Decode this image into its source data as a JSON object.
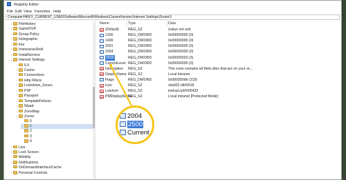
{
  "window": {
    "title": "Registry Editor",
    "menu": [
      "File",
      "Edit",
      "View",
      "Favorites",
      "Help"
    ],
    "address": "Computer\\HKEY_CURRENT_USER\\Software\\Microsoft\\Windows\\CurrentVersion\\Internet Settings\\Zones\\1"
  },
  "tree": {
    "items": [
      {
        "label": "FileHistory",
        "depth": 0,
        "expandable": true
      },
      {
        "label": "GameDVR",
        "depth": 0,
        "expandable": true
      },
      {
        "label": "Group Policy",
        "depth": 0,
        "expandable": true
      },
      {
        "label": "Holographic",
        "depth": 0,
        "expandable": true
      },
      {
        "label": "ime",
        "depth": 0,
        "expandable": true
      },
      {
        "label": "ImmersiveShell",
        "depth": 0,
        "expandable": true
      },
      {
        "label": "InstallService",
        "depth": 0,
        "expandable": true
      },
      {
        "label": "Internet Settings",
        "depth": 0,
        "expandable": true,
        "expanded": true
      },
      {
        "label": "5.0",
        "depth": 1,
        "expandable": true
      },
      {
        "label": "Cache",
        "depth": 1,
        "expandable": true
      },
      {
        "label": "Connections",
        "depth": 1,
        "expandable": false
      },
      {
        "label": "Http Filters",
        "depth": 1,
        "expandable": true
      },
      {
        "label": "Lockdown_Zones",
        "depth": 1,
        "expandable": true
      },
      {
        "label": "P3P",
        "depth": 1,
        "expandable": true
      },
      {
        "label": "Passport",
        "depth": 1,
        "expandable": true
      },
      {
        "label": "TemplatePolicies",
        "depth": 1,
        "expandable": true
      },
      {
        "label": "Wpad",
        "depth": 1,
        "expandable": true
      },
      {
        "label": "ZoneMap",
        "depth": 1,
        "expandable": true
      },
      {
        "label": "Zones",
        "depth": 1,
        "expandable": true,
        "expanded": true
      },
      {
        "label": "0",
        "depth": 2,
        "expandable": false
      },
      {
        "label": "1",
        "depth": 2,
        "expandable": false,
        "selected": true
      },
      {
        "label": "2",
        "depth": 2,
        "expandable": false
      },
      {
        "label": "3",
        "depth": 2,
        "expandable": false
      },
      {
        "label": "4",
        "depth": 2,
        "expandable": false
      },
      {
        "label": "Live",
        "depth": 0,
        "expandable": true
      },
      {
        "label": "Lock Screen",
        "depth": 0,
        "expandable": true
      },
      {
        "label": "Mobility",
        "depth": 0,
        "expandable": false
      },
      {
        "label": "Notifications",
        "depth": 0,
        "expandable": true
      },
      {
        "label": "OnDemandInterfaceCache",
        "depth": 0,
        "expandable": false
      },
      {
        "label": "Personal Controls",
        "depth": 0,
        "expandable": true
      }
    ]
  },
  "list": {
    "headers": {
      "name": "Name",
      "type": "Type",
      "data": "Data"
    },
    "rows": [
      {
        "icon": "string-value-icon",
        "name": "(Default)",
        "type": "REG_SZ",
        "data": "(value not set)"
      },
      {
        "icon": "dword-value-icon",
        "name": "1200",
        "type": "REG_DWORD",
        "data": "0x00000000 (0)"
      },
      {
        "icon": "dword-value-icon",
        "name": "1400",
        "type": "REG_DWORD",
        "data": "0x00000000 (0)"
      },
      {
        "icon": "dword-value-icon",
        "name": "2001",
        "type": "REG_DWORD",
        "data": "0x00000000 (0)"
      },
      {
        "icon": "dword-value-icon",
        "name": "2004",
        "type": "REG_DWORD",
        "data": "0x00000000 (0)"
      },
      {
        "icon": "dword-value-icon",
        "name": "2500",
        "type": "REG_DWORD",
        "data": "0x00000003 (3)",
        "selected": true
      },
      {
        "icon": "dword-value-icon",
        "name": "CurrentLevel",
        "type": "REG_DWORD",
        "data": "0x00000000 (0)"
      },
      {
        "icon": "string-value-icon",
        "name": "Description",
        "type": "REG_SZ",
        "data": "This zone contains all Web sites that are on your or..."
      },
      {
        "icon": "string-value-icon",
        "name": "DisplayName",
        "type": "REG_SZ",
        "data": "Local intranet"
      },
      {
        "icon": "dword-value-icon",
        "name": "Flags",
        "type": "REG_DWORD",
        "data": "0x000000db (219)"
      },
      {
        "icon": "string-value-icon",
        "name": "Icon",
        "type": "REG_SZ",
        "data": "shell32.dll#0018"
      },
      {
        "icon": "string-value-icon",
        "name": "LowIcon",
        "type": "REG_SZ",
        "data": "inetcpl.cpl#005423"
      },
      {
        "icon": "string-value-icon",
        "name": "PMDisplayName",
        "type": "REG_SZ",
        "data": "Local intranet [Protected Mode]"
      }
    ]
  },
  "magnifier": {
    "rows": [
      {
        "text": "2004",
        "selected": false
      },
      {
        "text": "2500",
        "selected": true
      },
      {
        "text": "Current",
        "selected": false
      }
    ],
    "accent_color": "#f5c518"
  },
  "colors": {
    "selection": "#3d7bd7",
    "folder": "#e8c15a",
    "callout": "#f5c518"
  }
}
